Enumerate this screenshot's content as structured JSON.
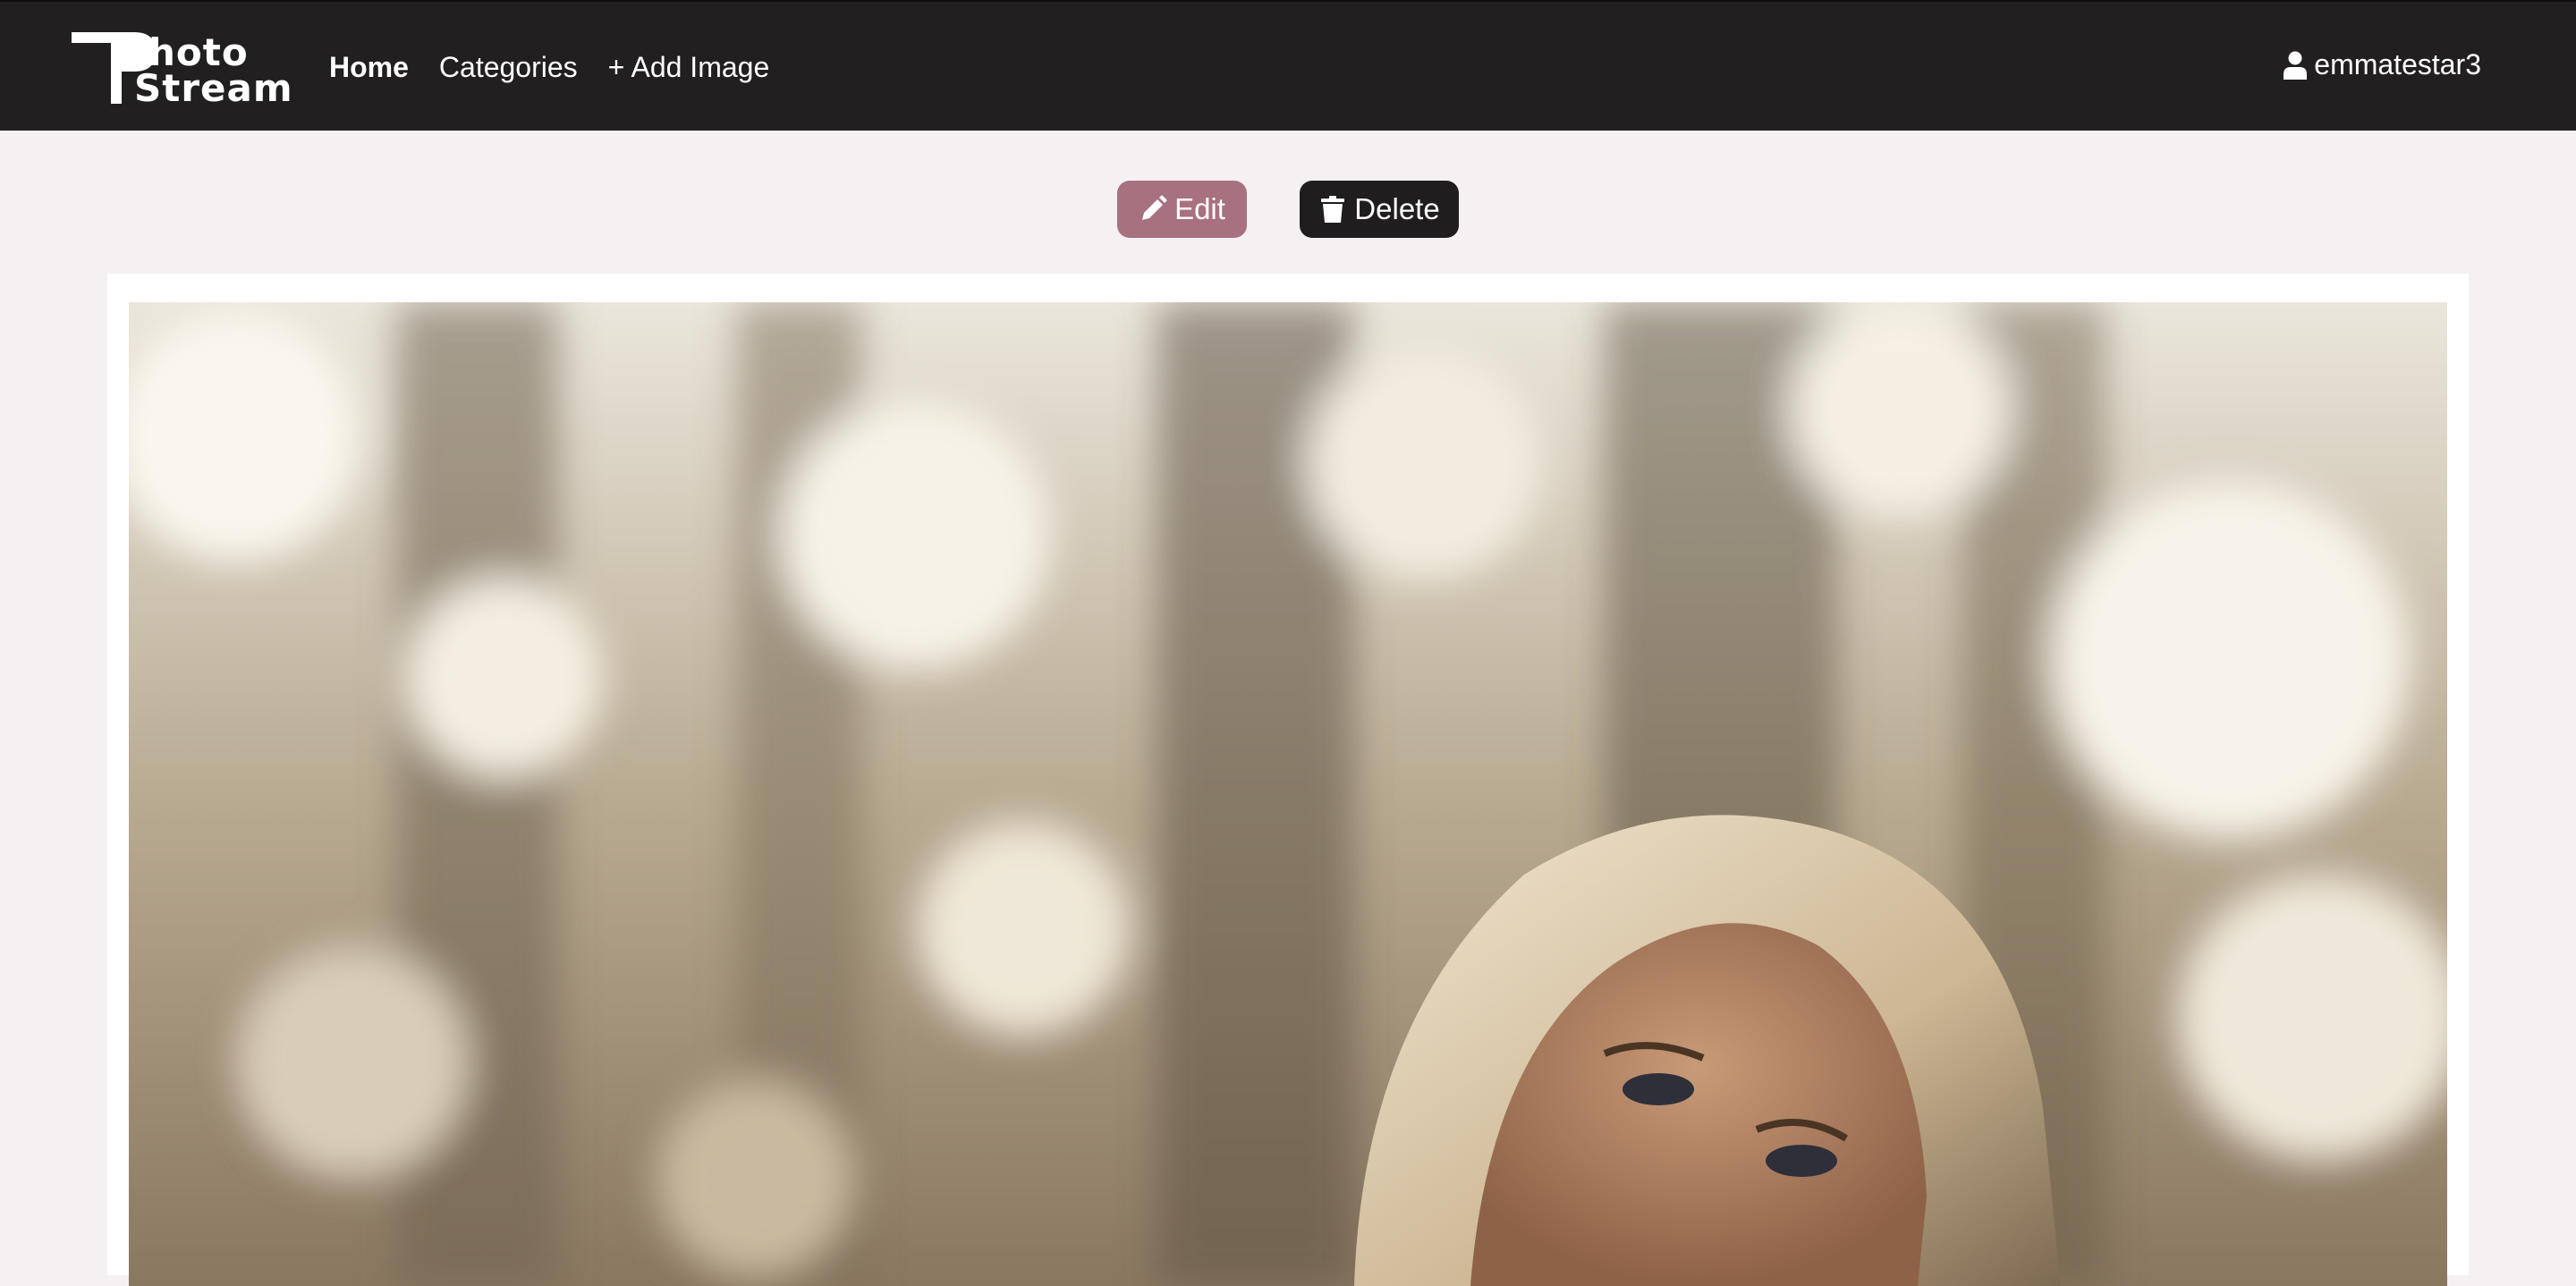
{
  "navbar": {
    "brand_line1": "hoto",
    "brand_line2": "Stream",
    "links": [
      {
        "label": "Home",
        "active": true
      },
      {
        "label": "Categories",
        "active": false
      },
      {
        "label": "+ Add Image",
        "active": false
      }
    ],
    "username": "emmatestar3",
    "user_icon": "user-icon"
  },
  "actions": {
    "edit_label": "Edit",
    "edit_icon": "pencil-icon",
    "delete_label": "Delete",
    "delete_icon": "trash-icon"
  },
  "colors": {
    "navbar": "#221f20",
    "page_bg": "#f5f1f2",
    "edit_button": "#a8717f",
    "delete_button": "#1f1d1e"
  }
}
